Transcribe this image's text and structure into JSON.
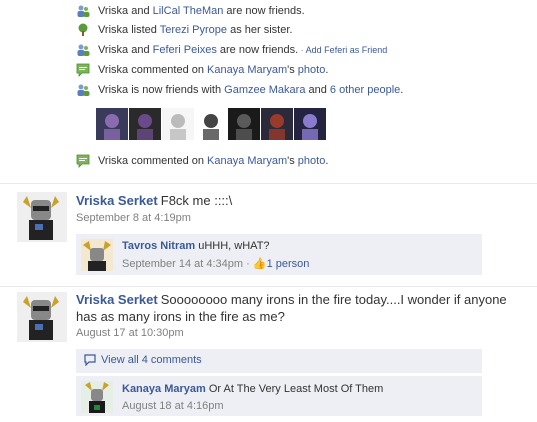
{
  "activities": [
    {
      "icon": "friends-icon",
      "parts": [
        [
          "text",
          "Vriska and "
        ],
        [
          "link",
          "LilCal TheMan"
        ],
        [
          "text",
          " are now friends."
        ]
      ]
    },
    {
      "icon": "relationship-icon",
      "parts": [
        [
          "text",
          "Vriska listed "
        ],
        [
          "link",
          "Terezi Pyrope"
        ],
        [
          "text",
          " as her sister."
        ]
      ]
    },
    {
      "icon": "friends-icon",
      "parts": [
        [
          "text",
          "Vriska and "
        ],
        [
          "link",
          "Feferi Peixes"
        ],
        [
          "text",
          " are now friends."
        ]
      ],
      "extra": "Add Feferi as Friend"
    },
    {
      "icon": "comment-icon",
      "parts": [
        [
          "text",
          "Vriska commented on "
        ],
        [
          "link",
          "Kanaya Maryam"
        ],
        [
          "text",
          "'s "
        ],
        [
          "link",
          "photo"
        ],
        [
          "text",
          "."
        ]
      ]
    },
    {
      "icon": "friends-icon",
      "parts": [
        [
          "text",
          "Vriska is now friends with "
        ],
        [
          "link",
          "Gamzee Makara"
        ],
        [
          "text",
          " and "
        ],
        [
          "link",
          "6 other people"
        ],
        [
          "text",
          "."
        ]
      ]
    },
    {
      "icon": "comment-icon",
      "parts": [
        [
          "text",
          "Vriska commented on "
        ],
        [
          "link",
          "Kanaya Maryam"
        ],
        [
          "text",
          "'s "
        ],
        [
          "link",
          "photo"
        ],
        [
          "text",
          "."
        ]
      ]
    }
  ],
  "friend_thumbnails": 7,
  "posts": [
    {
      "author": "Vriska Serket",
      "message": "F8ck me ::::\\",
      "time": "September 8 at 4:19pm",
      "comments": [
        {
          "author": "Tavros Nitram",
          "text": "uHHH, wHAT?",
          "time": "September 14 at 4:34pm",
          "likes": "1 person"
        }
      ]
    },
    {
      "author": "Vriska Serket",
      "message": "Soooooooo many irons in the fire today....I wonder if anyone has as many irons in the fire as me?",
      "time": "August 17 at 10:30pm",
      "view_all": "View all 4 comments",
      "comments": [
        {
          "author": "Kanaya Maryam",
          "text": "Or At The Very Least Most Of Them",
          "time": "August 18 at 4:16pm"
        }
      ]
    }
  ],
  "colors": {
    "link": "#3b5998",
    "meta": "#808080",
    "comment_bg": "#edeff4",
    "divider": "#e9e9e9"
  }
}
